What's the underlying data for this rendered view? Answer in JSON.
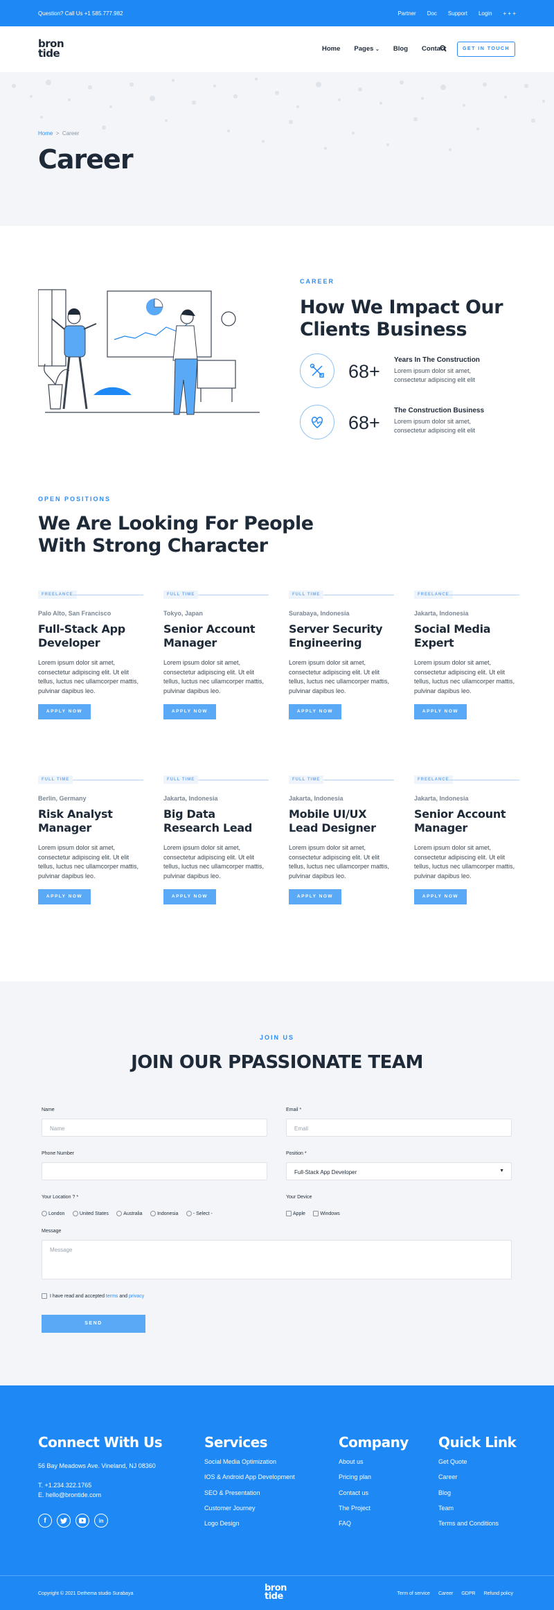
{
  "topbar": {
    "question": "Question? Call Us +1 585.777.982",
    "links": [
      "Partner",
      "Doc",
      "Support",
      "Login",
      "+ + +"
    ]
  },
  "header": {
    "logo_line1": "bron",
    "logo_line2": "tide",
    "nav": [
      "Home",
      "Pages",
      "Blog",
      "Contact"
    ],
    "cta": "GET IN TOUCH"
  },
  "hero": {
    "breadcrumb_home": "Home",
    "breadcrumb_sep": ">",
    "breadcrumb_current": "Career",
    "title": "Career"
  },
  "impact": {
    "eyebrow": "CAREER",
    "title_line1": "How We Impact Our",
    "title_line2": "Clients Business",
    "stats": [
      {
        "icon": "tools-icon",
        "number": "68+",
        "title": "Years In The Construction",
        "desc": "Lorem ipsum dolor sit amet, consectetur adipiscing elit elit"
      },
      {
        "icon": "heartbeat-icon",
        "number": "68+",
        "title": "The Construction Business",
        "desc": "Lorem ipsum dolor sit amet, consectetur adipiscing elit elit"
      }
    ]
  },
  "positions": {
    "eyebrow": "OPEN POSITIONS",
    "title_line1": "We Are Looking For People",
    "title_line2": "With Strong Character",
    "apply_label": "APPLY NOW",
    "jobs": [
      {
        "tag": "FREELANCE",
        "location": "Palo Alto, San Francisco",
        "title": "Full-Stack App Developer",
        "desc": "Lorem ipsum dolor sit amet, consectetur adipiscing elit. Ut elit tellus, luctus nec ullamcorper mattis, pulvinar dapibus leo."
      },
      {
        "tag": "FULL TIME",
        "location": "Tokyo, Japan",
        "title": "Senior Account Manager",
        "desc": "Lorem ipsum dolor sit amet, consectetur adipiscing elit. Ut elit tellus, luctus nec ullamcorper mattis, pulvinar dapibus leo."
      },
      {
        "tag": "FULL TIME",
        "location": "Surabaya, Indonesia",
        "title": "Server Security Engineering",
        "desc": "Lorem ipsum dolor sit amet, consectetur adipiscing elit. Ut elit tellus, luctus nec ullamcorper mattis, pulvinar dapibus leo."
      },
      {
        "tag": "FREELANCE",
        "location": "Jakarta, Indonesia",
        "title": "Social Media Expert",
        "desc": "Lorem ipsum dolor sit amet, consectetur adipiscing elit. Ut elit tellus, luctus nec ullamcorper mattis, pulvinar dapibus leo."
      },
      {
        "tag": "FULL TIME",
        "location": "Berlin, Germany",
        "title": "Risk Analyst Manager",
        "desc": "Lorem ipsum dolor sit amet, consectetur adipiscing elit. Ut elit tellus, luctus nec ullamcorper mattis, pulvinar dapibus leo."
      },
      {
        "tag": "FULL TIME",
        "location": "Jakarta, Indonesia",
        "title": "Big Data Research Lead",
        "desc": "Lorem ipsum dolor sit amet, consectetur adipiscing elit. Ut elit tellus, luctus nec ullamcorper mattis, pulvinar dapibus leo."
      },
      {
        "tag": "FULL TIME",
        "location": "Jakarta, Indonesia",
        "title": "Mobile UI/UX Lead Designer",
        "desc": "Lorem ipsum dolor sit amet, consectetur adipiscing elit. Ut elit tellus, luctus nec ullamcorper mattis, pulvinar dapibus leo."
      },
      {
        "tag": "FREELANCE",
        "location": "Jakarta, Indonesia",
        "title": "Senior Account Manager",
        "desc": "Lorem ipsum dolor sit amet, consectetur adipiscing elit. Ut elit tellus, luctus nec ullamcorper mattis, pulvinar dapibus leo."
      }
    ]
  },
  "join": {
    "eyebrow": "JOIN US",
    "title": "JOIN OUR PPASSIONATE TEAM",
    "name_label": "Name",
    "name_placeholder": "Name",
    "email_label": "Email *",
    "email_placeholder": "Email",
    "phone_label": "Phone Number",
    "position_label": "Position *",
    "position_value": "Full-Stack App Developer",
    "location_label": "Your Location ? *",
    "locations": [
      "London",
      "United States",
      "Australia",
      "Indonesia",
      "- Select -"
    ],
    "device_label": "Your Device",
    "devices": [
      "Apple",
      "Windows"
    ],
    "message_label": "Message",
    "message_placeholder": "Message",
    "consent_prefix": "I have read and accepted",
    "consent_terms": "terms",
    "consent_and": "and",
    "consent_privacy": "privacy",
    "send": "SEND"
  },
  "footer": {
    "connect_title": "Connect With Us",
    "address": "56 Bay Meadows Ave. Vineland, NJ 08360",
    "phone": "T. +1.234.322.1765",
    "email": "E. hello@brontide.com",
    "socials": [
      "facebook-icon",
      "twitter-icon",
      "youtube-icon",
      "linkedin-icon"
    ],
    "services_title": "Services",
    "services": [
      "Social Media Optimization",
      "IOS & Android App Development",
      "SEO & Presentation",
      "Customer Journey",
      "Logo Design"
    ],
    "company_title": "Company",
    "company": [
      "About us",
      "Pricing plan",
      "Contact us",
      "The Project",
      "FAQ"
    ],
    "quick_title": "Quick Link",
    "quick": [
      "Get Quote",
      "Career",
      "Blog",
      "Team",
      "Terms and Conditions"
    ],
    "copyright": "Copyright © 2021 Dethema studio Surabaya",
    "logo_line1": "bron",
    "logo_line2": "tide",
    "bottom_links": [
      "Term of service",
      "Career",
      "GDPR",
      "Refund policy"
    ]
  },
  "colors": {
    "brand": "#1e88f5",
    "accent": "#2b8cf5",
    "button": "#5aa9f7",
    "hero_bg": "#f3f5f8"
  }
}
